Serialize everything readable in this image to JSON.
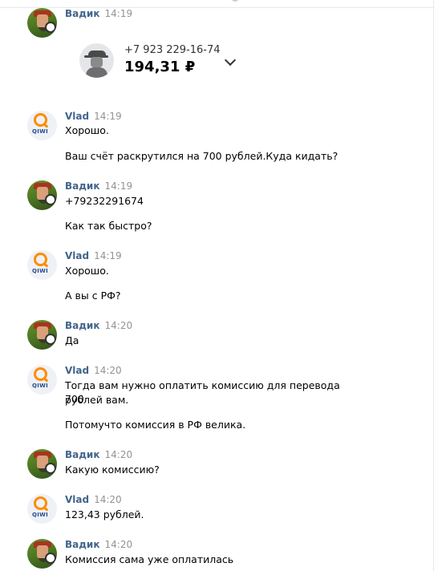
{
  "messages": [
    {
      "author": "Вадик",
      "time": "14:19",
      "card": {
        "phone": "+7 923 229-16-74",
        "amount": "194,31 ₽"
      }
    },
    {
      "author": "Vlad",
      "time": "14:19",
      "lines": [
        "Хорошо.",
        "Ваш счёт раскрутился на 700 рублей.Куда кидать?"
      ]
    },
    {
      "author": "Вадик",
      "time": "14:19",
      "lines": [
        "+79232291674",
        "Как так быстро?"
      ]
    },
    {
      "author": "Vlad",
      "time": "14:19",
      "lines": [
        "Хорошо.",
        "А вы с РФ?"
      ]
    },
    {
      "author": "Вадик",
      "time": "14:20",
      "lines": [
        "Да"
      ]
    },
    {
      "author": "Vlad",
      "time": "14:20",
      "lines": [
        "Тогда вам нужно оплатить комиссию для перевода 700",
        "рублей вам.",
        "Потомучто комиссия в РФ велика."
      ]
    },
    {
      "author": "Вадик",
      "time": "14:20",
      "lines": [
        "Какую комиссию?"
      ]
    },
    {
      "author": "Vlad",
      "time": "14:20",
      "lines": [
        "123,43 рублей."
      ]
    },
    {
      "author": "Вадик",
      "time": "14:20",
      "lines": [
        "Комиссия сама уже оплатилась"
      ]
    }
  ],
  "qiwi_logo_text": "QIWI",
  "icons": {
    "expand": "chevron-down-icon"
  }
}
